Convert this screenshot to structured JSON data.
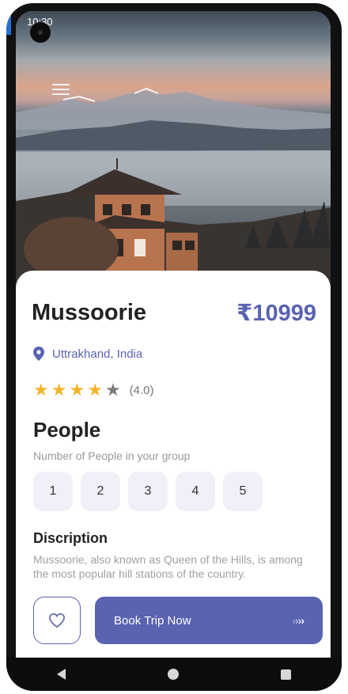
{
  "status_bar": {
    "time": "10:30"
  },
  "destination": {
    "name": "Mussoorie",
    "price": "₹10999",
    "location": "Uttrakhand, India",
    "rating_stars": 4,
    "rating_text": "(4.0)"
  },
  "people": {
    "title": "People",
    "subtitle": "Number of People in your group",
    "options": [
      "1",
      "2",
      "3",
      "4",
      "5"
    ]
  },
  "description": {
    "title": "Discription",
    "text": "Mussoorie, also known as Queen of the Hills, is among the most popular hill stations of the country."
  },
  "actions": {
    "book_label": "Book Trip Now"
  },
  "colors": {
    "accent": "#5a63b0",
    "star": "#f1b52b",
    "chip_bg": "#f0f1f8"
  }
}
